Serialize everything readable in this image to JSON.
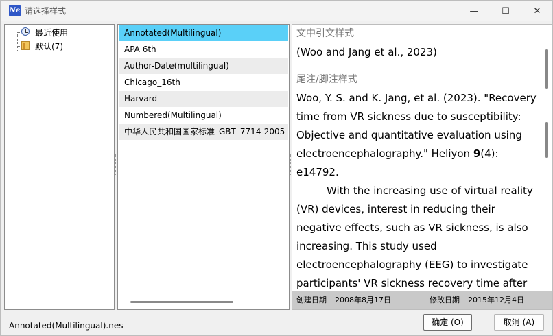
{
  "window": {
    "title": "请选择样式",
    "app_icon_text": "Ne",
    "minimize": "—",
    "maximize": "☐",
    "close": "✕"
  },
  "tree": {
    "items": [
      {
        "label": "最近使用",
        "icon": "clock-icon"
      },
      {
        "label": "默认(7)",
        "icon": "book-icon"
      }
    ]
  },
  "styles_list": {
    "selected_index": 0,
    "items": [
      "Annotated(Multilingual)",
      "APA 6th",
      "Author-Date(multilingual)",
      "Chicago_16th",
      "Harvard",
      "Numbered(Multilingual)",
      "中华人民共和国国家标准_GBT_7714-2005"
    ]
  },
  "preview": {
    "in_text_heading": "文中引文样式",
    "in_text_citation": "(Woo and Jang et al., 2023)",
    "footnote_heading": "尾注/脚注样式",
    "ref_part1": "Woo, Y. S. and K. Jang, et al. (2023). \"Recovery time from VR sickness due to susceptibility: Objective and quantitative evaluation using electroencephalography.\" ",
    "ref_journal": "Heliyon",
    "ref_volume": "9",
    "ref_part2": "(4): e14792.",
    "abstract": "With the increasing use of virtual reality (VR) devices, interest in reducing their negative effects, such as VR sickness, is also increasing. This study used electroencephalography (EEG) to investigate",
    "abstract_cut": "participants' VR sickness recovery time after",
    "created_label": "创建日期",
    "created_value": "2008年8月17日",
    "modified_label": "修改日期",
    "modified_value": "2015年12月4日"
  },
  "status": {
    "filename": "Annotated(Multilingual).nes"
  },
  "buttons": {
    "ok": "确定 (O)",
    "cancel": "取消 (A)"
  },
  "colors": {
    "selection": "#5ad0f8",
    "footer": "#c9c9c9",
    "accent": "#2f57c7"
  }
}
